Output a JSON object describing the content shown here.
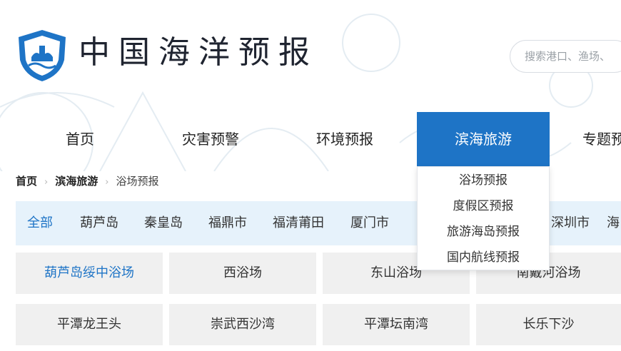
{
  "header": {
    "site_title": "中国海洋预报",
    "search_placeholder": "搜索港口、渔场、"
  },
  "nav": {
    "items": [
      {
        "label": "首页"
      },
      {
        "label": "灾害预警"
      },
      {
        "label": "环境预报"
      },
      {
        "label": "滨海旅游"
      },
      {
        "label": "专题预"
      }
    ],
    "active_index": 3
  },
  "dropdown": {
    "items": [
      {
        "label": "浴场预报"
      },
      {
        "label": "度假区预报"
      },
      {
        "label": "旅游海岛预报"
      },
      {
        "label": "国内航线预报"
      }
    ]
  },
  "breadcrumb": {
    "home": "首页",
    "section": "滨海旅游",
    "current": "浴场预报",
    "separator": "›"
  },
  "regions": {
    "items": [
      {
        "label": "全部"
      },
      {
        "label": "葫芦岛"
      },
      {
        "label": "秦皇岛"
      },
      {
        "label": "福鼎市"
      },
      {
        "label": "福清莆田"
      },
      {
        "label": "厦门市"
      },
      {
        "label": "深圳市"
      },
      {
        "label": "海"
      }
    ],
    "active_index": 0
  },
  "beaches": {
    "row1": [
      {
        "label": "葫芦岛绥中浴场"
      },
      {
        "label": "西浴场"
      },
      {
        "label": "东山浴场"
      },
      {
        "label": "南戴河浴场"
      }
    ],
    "row2": [
      {
        "label": "平潭龙王头"
      },
      {
        "label": "崇武西沙湾"
      },
      {
        "label": "平潭坛南湾"
      },
      {
        "label": "长乐下沙"
      }
    ]
  },
  "colors": {
    "accent": "#1e74c6",
    "region_bar": "#e6f2fb",
    "tile": "#f0f0f0"
  },
  "icons": {
    "logo": "ocean-forecast-shield-logo",
    "separator": "chevron-right-icon"
  }
}
